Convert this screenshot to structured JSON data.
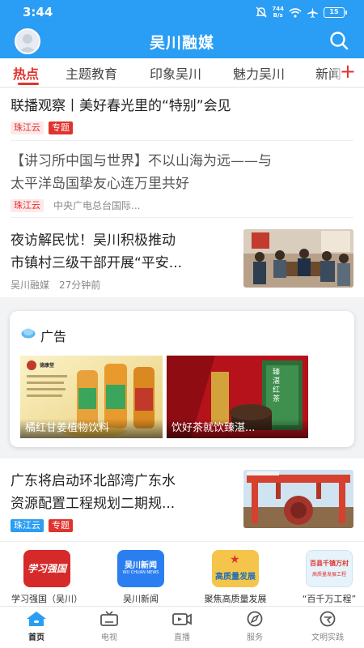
{
  "status_bar": {
    "time": "3:44",
    "net_speed_value": "744",
    "net_speed_unit": "B/s",
    "battery": "15"
  },
  "header": {
    "title": "吴川融媒"
  },
  "tabs": [
    {
      "label": "热点",
      "active": true
    },
    {
      "label": "主题教育",
      "active": false
    },
    {
      "label": "印象吴川",
      "active": false
    },
    {
      "label": "魅力吴川",
      "active": false
    },
    {
      "label": "新闻",
      "active": false
    }
  ],
  "tab_add_symbol": "+",
  "feed": [
    {
      "title_line1": "联播观察丨美好春光里的“特别”会见",
      "tags": [
        "珠江云",
        "专题"
      ]
    },
    {
      "title_line1": "【讲习所中国与世界】不以山海为远——与",
      "title_line2": "太平洋岛国挚友心连万里共好",
      "source_tag": "珠江云",
      "source": "中央广电总台国际..."
    },
    {
      "title_line1": "夜访解民忧！吴川积极推动",
      "title_line2": "市镇村三级干部开展“平安...",
      "source": "吴川融媒",
      "time": "27分钟前"
    },
    {
      "title_line1": "广东将启动环北部湾广东水",
      "title_line2": "资源配置工程规划二期规...",
      "tags": [
        "珠江云",
        "专题"
      ]
    }
  ],
  "ad": {
    "title": "广告",
    "items": [
      {
        "caption": "橘红甘姜植物饮料",
        "brand_text": "德康堂"
      },
      {
        "caption": "饮好茶就饮臻湛...",
        "brand_text": "臻湛红茶"
      }
    ]
  },
  "shortcuts": [
    {
      "label": "学习强国（吴川）",
      "icon_text": "学习强国",
      "color": "#d62a2a"
    },
    {
      "label": "吴川新闻",
      "icon_text": "吴川新闻",
      "icon_subtext": "WU CHUAN NEWS",
      "color": "#2a7ef0"
    },
    {
      "label": "聚焦高质量发展",
      "icon_text": "高质量发展",
      "color": "#f4c54a"
    },
    {
      "label": "“百千万工程”",
      "icon_text": "百县千镇万村",
      "icon_subtext": "高质量发展工程",
      "color": "#e6f3fb"
    }
  ],
  "bottom_nav": [
    {
      "label": "首页",
      "active": true
    },
    {
      "label": "电视",
      "active": false
    },
    {
      "label": "直播",
      "active": false
    },
    {
      "label": "服务",
      "active": false
    },
    {
      "label": "文明实践",
      "active": false
    }
  ],
  "colors": {
    "brand_blue": "#2a9df4",
    "accent_red": "#e0332e"
  }
}
